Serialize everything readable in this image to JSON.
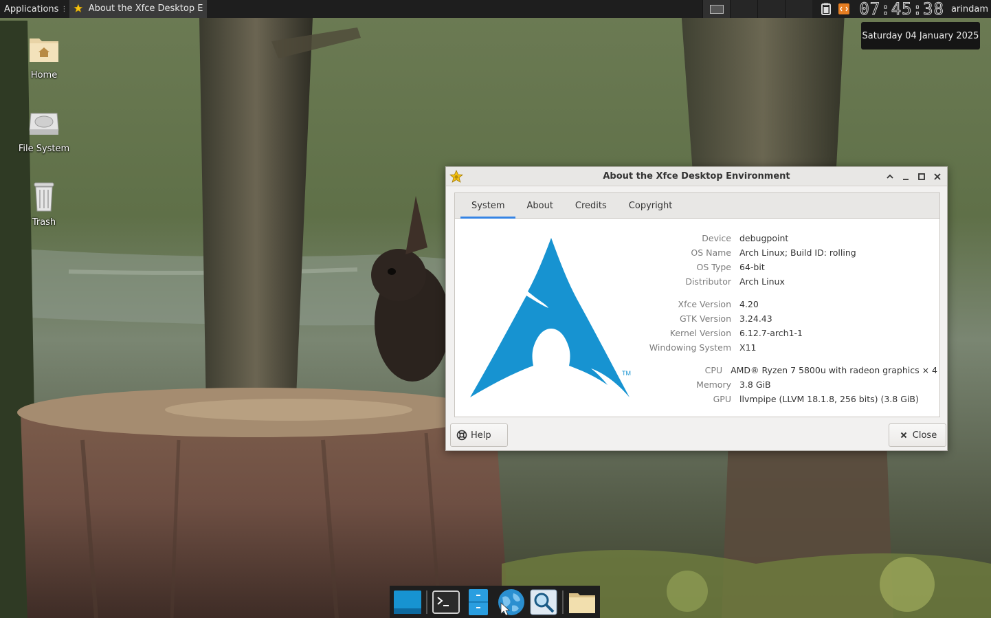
{
  "top_panel": {
    "applications_label": "Applications",
    "applications_separator": "⋮",
    "task_title": "About the Xfce Desktop Env...",
    "clock": "07:45:38",
    "user": "arindam",
    "tooltip": "Saturday 04 January 2025"
  },
  "desktop_icons": [
    {
      "label": "Home",
      "icon": "home-folder-icon"
    },
    {
      "label": "File System",
      "icon": "hard-drive-icon"
    },
    {
      "label": "Trash",
      "icon": "trash-icon"
    }
  ],
  "dialog": {
    "title": "About the Xfce Desktop Environment",
    "tabs": [
      "System",
      "About",
      "Credits",
      "Copyright"
    ],
    "active_tab": "System",
    "info": {
      "device": {
        "label": "Device",
        "value": "debugpoint"
      },
      "os_name": {
        "label": "OS Name",
        "value": "Arch Linux; Build ID: rolling"
      },
      "os_type": {
        "label": "OS Type",
        "value": "64-bit"
      },
      "distributor": {
        "label": "Distributor",
        "value": "Arch Linux"
      },
      "xfce_version": {
        "label": "Xfce Version",
        "value": "4.20"
      },
      "gtk_version": {
        "label": "GTK Version",
        "value": "3.24.43"
      },
      "kernel_version": {
        "label": "Kernel Version",
        "value": "6.12.7-arch1-1"
      },
      "windowing_system": {
        "label": "Windowing System",
        "value": "X11"
      },
      "cpu": {
        "label": "CPU",
        "value": "AMD® Ryzen 7 5800u with radeon graphics × 4"
      },
      "memory": {
        "label": "Memory",
        "value": "3.8 GiB"
      },
      "gpu": {
        "label": "GPU",
        "value": "llvmpipe (LLVM 18.1.8, 256 bits) (3.8 GiB)"
      }
    },
    "logo_tm": "TM",
    "help_label": "Help",
    "close_label": "Close"
  },
  "dock": {
    "items": [
      "show-desktop-icon",
      "terminal-icon",
      "file-manager-icon",
      "web-browser-icon",
      "app-finder-icon",
      "folder-icon"
    ]
  },
  "colors": {
    "arch_blue": "#1793d1",
    "panel_bg": "#1e1e1e",
    "tab_accent": "#3584e4"
  }
}
